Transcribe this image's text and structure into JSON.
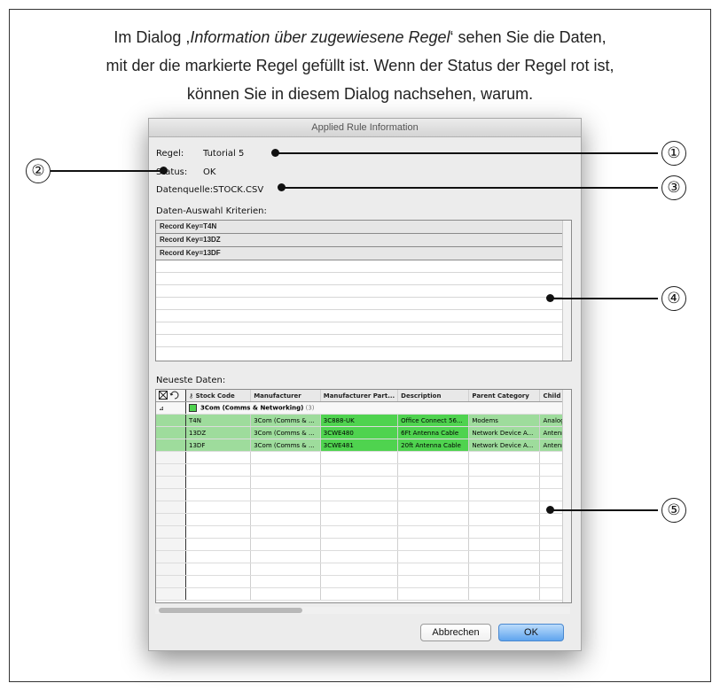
{
  "caption": {
    "line1_pre": "Im Dialog ,",
    "line1_italic": "Information über zugewiesene Regel",
    "line1_post": "‘ sehen Sie die Daten,",
    "line2": "mit der die markierte Regel gefüllt ist. Wenn der Status der Regel rot ist,",
    "line3": "können Sie in diesem Dialog nachsehen, warum."
  },
  "dialog": {
    "title": "Applied Rule Information",
    "rule_label": "Regel:",
    "rule_value": "Tutorial 5",
    "status_label": "Status:",
    "status_value": "OK",
    "source_label": "Datenquelle:",
    "source_value": "STOCK.CSV",
    "criteria_label": "Daten-Auswahl Kriterien:",
    "criteria": [
      "Record Key=T4N",
      "Record Key=13DZ",
      "Record Key=13DF"
    ],
    "latest_label": "Neueste Daten:",
    "columns": [
      "Stock Code",
      "Manufacturer",
      "Manufacturer Part...",
      "Description",
      "Parent Category",
      "Child C"
    ],
    "group": {
      "name": "3Com (Comms & Networking)",
      "count": "(3)"
    },
    "rows": [
      [
        "T4N",
        "3Com (Comms & ...",
        "3C888-UK",
        "Office Connect 56...",
        "Modems",
        "Analog"
      ],
      [
        "13DZ",
        "3Com (Comms & ...",
        "3CWE480",
        "6Ft Antenna Cable",
        "Network Device A...",
        "Antenn"
      ],
      [
        "13DF",
        "3Com (Comms & ...",
        "3CWE481",
        "20ft Antenna Cable",
        "Network Device A...",
        "Antenn"
      ]
    ],
    "cancel_label": "Abbrechen",
    "ok_label": "OK"
  },
  "callouts": [
    "①",
    "②",
    "③",
    "④",
    "⑤"
  ],
  "colors": {
    "row_green": "#9edc9c",
    "cell_green": "#4fd34f",
    "ok_button": "#5fa4ee"
  }
}
